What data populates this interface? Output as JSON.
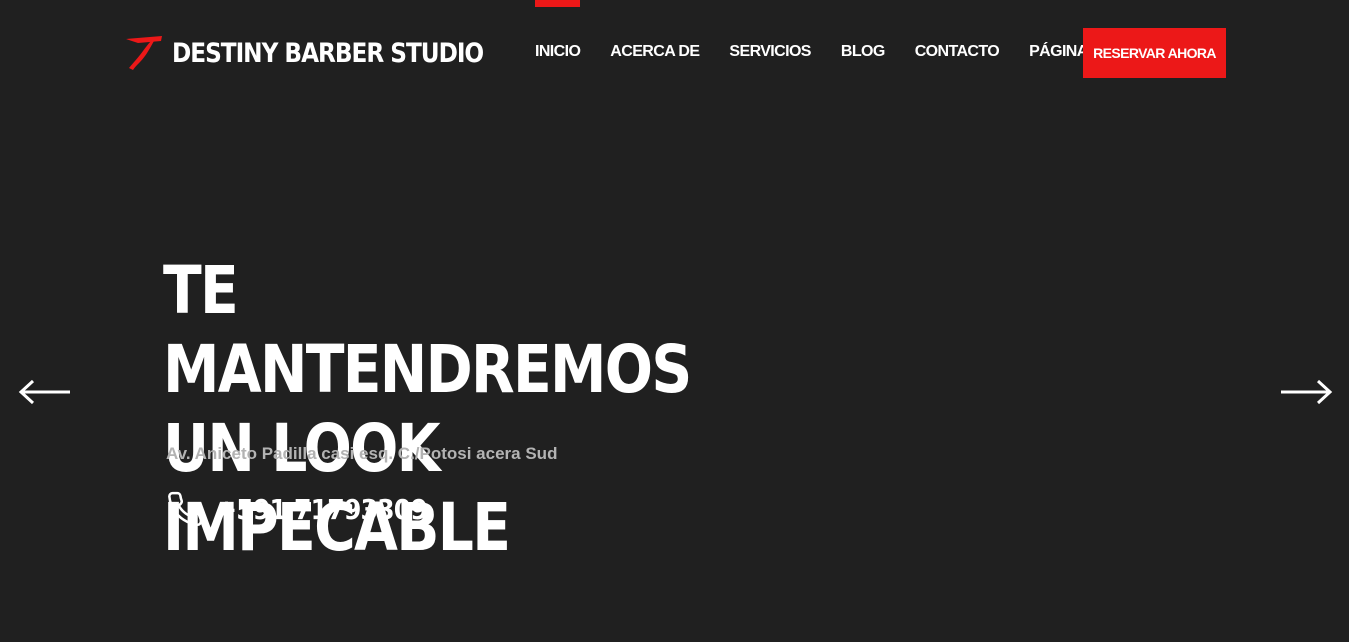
{
  "brand": {
    "name": "DESTINY BARBER STUDIO",
    "icon": "razor-logo-icon",
    "color": "#ec1818"
  },
  "nav": {
    "items": [
      {
        "label": "INICIO",
        "active": true
      },
      {
        "label": "ACERCA DE",
        "active": false
      },
      {
        "label": "SERVICIOS",
        "active": false
      },
      {
        "label": "BLOG",
        "active": false
      },
      {
        "label": "CONTACTO",
        "active": false
      },
      {
        "label": "PÁGINAS",
        "active": false
      }
    ]
  },
  "cta": {
    "label": "RESERVAR AHORA",
    "color": "#ec1818"
  },
  "hero": {
    "title": "TE MANTENDREMOS UN LOOK IMPECABLE",
    "address": "Av. Aniceto Padilla casi esq. C./Potosi acera Sud",
    "phone_icon": "phone-icon",
    "phone": "+591 71793309"
  },
  "slider": {
    "prev_icon": "arrow-left-icon",
    "next_icon": "arrow-right-icon"
  },
  "colors": {
    "background": "#202020",
    "accent": "#ec1818",
    "text": "#ffffff",
    "muted_text": "#b3b3b3"
  }
}
